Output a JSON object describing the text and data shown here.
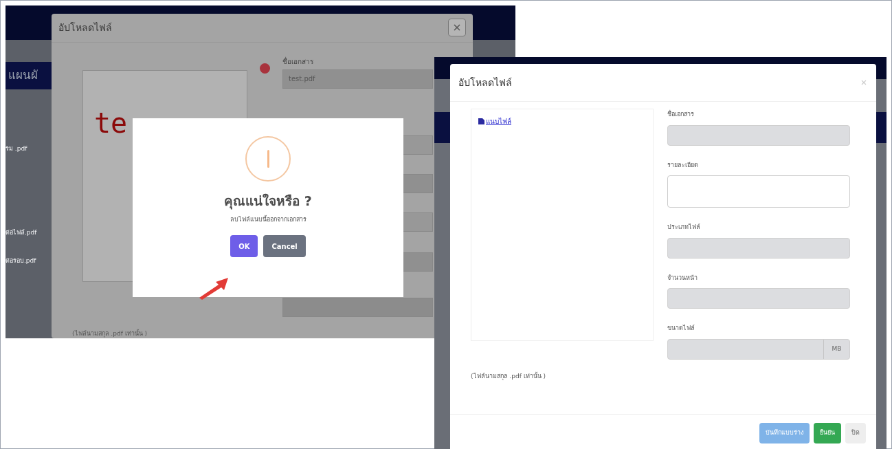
{
  "left_screenshot": {
    "background": {
      "header_text": "แผนผั",
      "list_items": [
        "รม .pdf",
        "ต่อไฟล์.pdf",
        "ต่อรอบ.pdf"
      ]
    },
    "modal": {
      "title": "อัปโหลดไฟล์",
      "document_name_label": "ชื่อเอกสาร",
      "document_name_value": "test.pdf",
      "preview_text": "te",
      "note": "(ไฟล์นามสกุล .pdf เท่านั้น )"
    },
    "confirm_dialog": {
      "title": "คุณแน่ใจหรือ ?",
      "message": "ลบไฟล์แนบนี้ออกจากเอกสาร",
      "buttons": [
        {
          "label": "OK",
          "kind": "confirm"
        },
        {
          "label": "Cancel",
          "kind": "cancel"
        }
      ]
    }
  },
  "right_screenshot": {
    "modal": {
      "title": "อัปโหลดไฟล์",
      "attach_link": "แนบไฟล์",
      "fields": [
        {
          "label": "ชื่อเอกสาร",
          "kind": "input"
        },
        {
          "label": "รายละเอียด",
          "kind": "textarea"
        },
        {
          "label": "ประเภทไฟล์",
          "kind": "input"
        },
        {
          "label": "จำนวนหน้า",
          "kind": "input"
        },
        {
          "label": "ขนาดไฟล์",
          "kind": "addon",
          "addon": "MB"
        }
      ],
      "note": "(ไฟล์นามสกุล .pdf เท่านั้น )",
      "buttons": [
        {
          "label": "บันทึกแบบร่าง",
          "kind": "draft"
        },
        {
          "label": "ยืนยัน",
          "kind": "confirm"
        },
        {
          "label": "ปิด",
          "kind": "close"
        }
      ]
    }
  }
}
